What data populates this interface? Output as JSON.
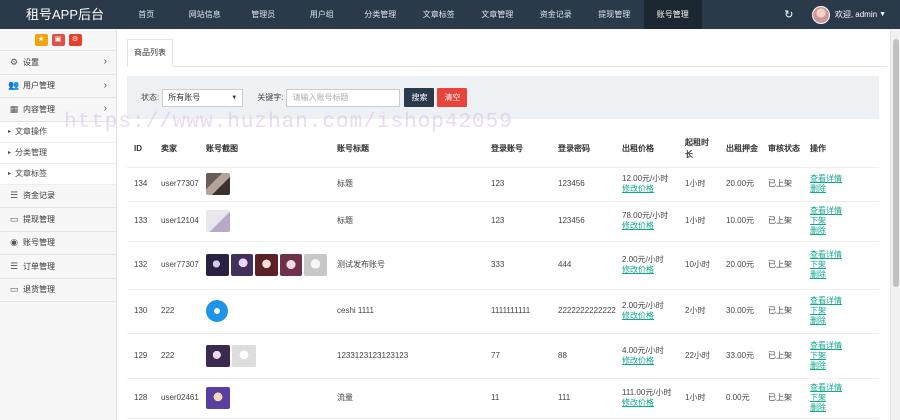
{
  "header": {
    "brand": "租号APP后台",
    "nav": [
      "首页",
      "网站信息",
      "管理员",
      "用户组",
      "分类管理",
      "文章标签",
      "文章管理",
      "资金记录",
      "提现管理",
      "账号管理"
    ],
    "active_nav_index": 9,
    "user_label": "欢迎, admin",
    "refresh_icon": "refresh-icon"
  },
  "sidebar": {
    "tools": [
      "star-icon",
      "trash-icon",
      "settings-icon"
    ],
    "items": [
      {
        "label": "设置",
        "icon": "gear-icon"
      },
      {
        "label": "用户管理",
        "icon": "users-icon"
      },
      {
        "label": "内容管理",
        "icon": "grid-icon"
      }
    ],
    "sub_items": [
      "文章操作",
      "分类管理",
      "文章标签"
    ],
    "more_items": [
      {
        "label": "资金记录",
        "icon": "list-icon"
      },
      {
        "label": "提现管理",
        "icon": "money-icon"
      },
      {
        "label": "账号管理",
        "icon": "camera-icon"
      },
      {
        "label": "订单管理",
        "icon": "order-icon"
      },
      {
        "label": "退货管理",
        "icon": "desktop-icon"
      }
    ]
  },
  "main": {
    "tab_label": "商品列表",
    "filters": {
      "status_label": "状态:",
      "status_value": "所有账号",
      "keyword_label": "关键字:",
      "keyword_placeholder": "请输入账号标题",
      "search_btn": "搜索",
      "clear_btn": "清空"
    },
    "table": {
      "headers": [
        "ID",
        "卖家",
        "账号截图",
        "账号标题",
        "登录账号",
        "登录密码",
        "出租价格",
        "起租时长",
        "出租押金",
        "审核状态",
        "操作"
      ],
      "rows": [
        {
          "id": "134",
          "seller": "user77307",
          "title": "标题",
          "login": "123",
          "password": "123456",
          "price": "12.00元/小时",
          "price_action": "修改价格",
          "duration": "1小时",
          "deposit": "20.00元",
          "status": "已上架",
          "actions": [
            "查看详情",
            "删除"
          ]
        },
        {
          "id": "133",
          "seller": "user12104",
          "title": "标题",
          "login": "123",
          "password": "123456",
          "price": "78.00元/小时",
          "price_action": "修改价格",
          "duration": "1小时",
          "deposit": "10.00元",
          "status": "已上架",
          "actions": [
            "查看详情",
            "下架",
            "删除"
          ]
        },
        {
          "id": "132",
          "seller": "user77307",
          "title": "测试发布账号",
          "login": "333",
          "password": "444",
          "price": "2.00元/小时",
          "price_action": "修改价格",
          "duration": "10小时",
          "deposit": "20.00元",
          "status": "已上架",
          "actions": [
            "查看详情",
            "下架",
            "删除"
          ]
        },
        {
          "id": "130",
          "seller": "222",
          "title": "ceshi 1111",
          "login": "1111111111",
          "password": "2222222222222",
          "price": "2.00元/小时",
          "price_action": "修改价格",
          "duration": "2小时",
          "deposit": "30.00元",
          "status": "已上架",
          "actions": [
            "查看详情",
            "下架",
            "删除"
          ]
        },
        {
          "id": "129",
          "seller": "222",
          "title": "1233123123123123",
          "login": "77",
          "password": "88",
          "price": "4.00元/小时",
          "price_action": "修改价格",
          "duration": "22小时",
          "deposit": "33.00元",
          "status": "已上架",
          "actions": [
            "查看详情",
            "下架",
            "删除"
          ]
        },
        {
          "id": "128",
          "seller": "user02461",
          "title": "流量",
          "login": "11",
          "password": "111",
          "price": "111.00元/小时",
          "price_action": "修改价格",
          "duration": "1小时",
          "deposit": "0.00元",
          "status": "已上架",
          "actions": [
            "查看详情",
            "下架",
            "删除"
          ]
        }
      ]
    }
  },
  "watermark": "https://www.huzhan.com/ishop42059",
  "colors": {
    "topbar": "#2b3a4a",
    "accent": "#10a88f",
    "danger": "#e9433a"
  }
}
